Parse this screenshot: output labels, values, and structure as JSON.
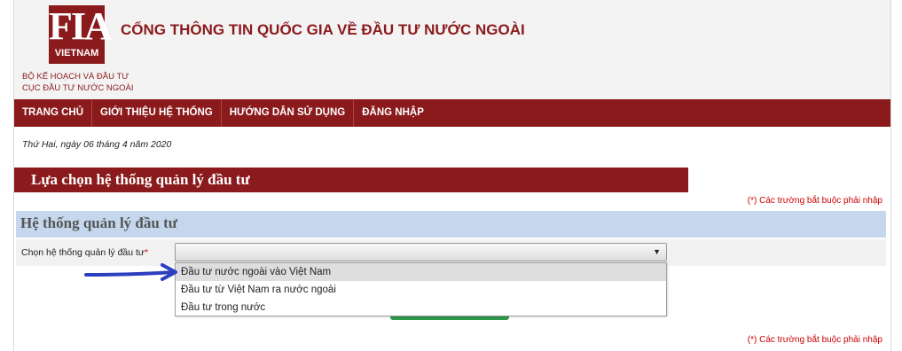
{
  "header": {
    "logo_text": "FIA",
    "logo_subtext": "VIETNAM",
    "site_title": "CỔNG THÔNG TIN QUỐC GIA VỀ ĐẦU TƯ NƯỚC NGOÀI",
    "ministry_line1": "BỘ KẾ HOẠCH VÀ ĐẦU TƯ",
    "ministry_line2": "CỤC ĐẦU TƯ NƯỚC NGOÀI"
  },
  "nav": {
    "items": [
      {
        "label": "TRANG CHỦ"
      },
      {
        "label": "GIỚI THIỆU HỆ THỐNG"
      },
      {
        "label": "HƯỚNG DẪN SỬ DỤNG"
      },
      {
        "label": "ĐĂNG NHẬP"
      }
    ]
  },
  "date_text": "Thứ Hai, ngày 06 tháng 4 năm 2020",
  "section": {
    "title": "Lựa chọn hệ thống quản lý đầu tư"
  },
  "required_note": "(*) Các trường bắt buộc phải nhập",
  "panel": {
    "title": "Hệ thống quản lý đầu tư"
  },
  "form": {
    "label": "Chọn hệ thống quản lý đầu tư",
    "required_mark": "*",
    "selected_value": "",
    "options": [
      {
        "label": "Đầu tư nước ngoài vào Việt Nam"
      },
      {
        "label": "Đầu tư từ Việt Nam ra nước ngoài"
      },
      {
        "label": "Đầu tư trong nước"
      }
    ]
  },
  "colors": {
    "brand": "#8b1a1c",
    "panel": "#c5d7ed",
    "required": "#cc0000",
    "annotation_arrow": "#2b3fbf",
    "button_green": "#2e9a4c"
  }
}
